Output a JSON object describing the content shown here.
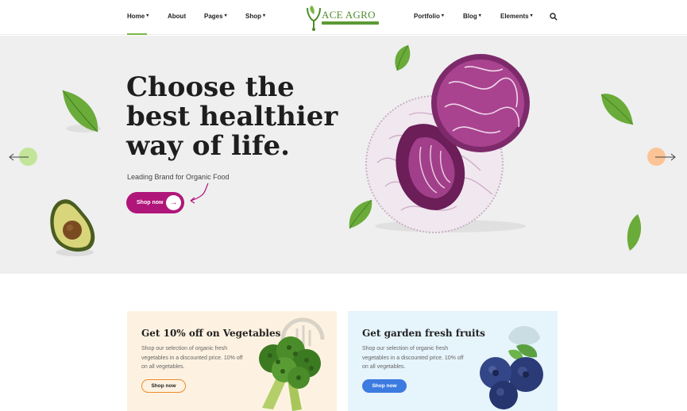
{
  "brand": {
    "name": "ACE AGRO"
  },
  "nav": {
    "left": [
      {
        "label": "Home",
        "dropdown": true
      },
      {
        "label": "About",
        "dropdown": false
      },
      {
        "label": "Pages",
        "dropdown": true
      },
      {
        "label": "Shop",
        "dropdown": true
      }
    ],
    "right": [
      {
        "label": "Portfolio",
        "dropdown": true
      },
      {
        "label": "Blog",
        "dropdown": true
      },
      {
        "label": "Elements",
        "dropdown": true
      }
    ],
    "active": "Home",
    "search_icon": "search-icon",
    "chevron_glyph": "▾"
  },
  "hero": {
    "headline": [
      "Choose the",
      "best healthier",
      "way of life."
    ],
    "subline": "Leading Brand for Organic Food",
    "button_label": "Shop now",
    "button_icon": "→",
    "prev_icon": "arrow-left-icon",
    "next_icon": "arrow-right-icon"
  },
  "promos": [
    {
      "title": "Get 10% off on Vegetables",
      "text": "Shop our selection of organic fresh vegetables in a discounted price. 10% off on all vegetables.",
      "button_label": "Shop now"
    },
    {
      "title": "Get garden fresh fruits",
      "text": "Shop our selection of organic fresh vegetables in a discounted price. 10% off on all vegetables.",
      "button_label": "Shop now"
    }
  ],
  "colors": {
    "accent_green": "#7ab648",
    "hero_button": "#b0167a",
    "veg_card_bg": "#fdf2e1",
    "fruit_card_bg": "#e6f4fb",
    "veg_button_border": "#f08c2a",
    "fruit_button": "#3c7be0"
  }
}
